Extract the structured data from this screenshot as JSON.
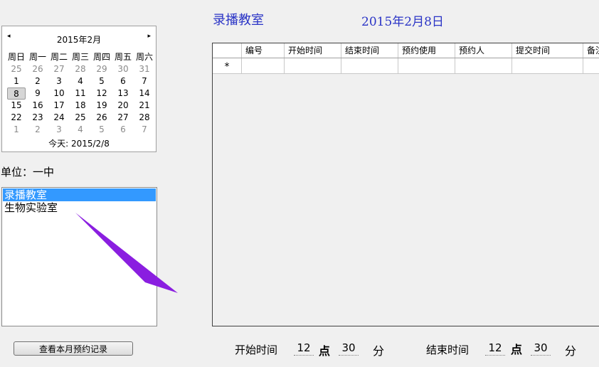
{
  "header": {
    "room_title": "录播教室",
    "date_title": "2015年2月8日"
  },
  "calendar": {
    "month_label": "2015年2月",
    "prev_glyph": "◂",
    "next_glyph": "▸",
    "weekdays": [
      "周日",
      "周一",
      "周二",
      "周三",
      "周四",
      "周五",
      "周六"
    ],
    "rows": [
      [
        "25",
        "26",
        "27",
        "28",
        "29",
        "30",
        "31"
      ],
      [
        "1",
        "2",
        "3",
        "4",
        "5",
        "6",
        "7"
      ],
      [
        "8",
        "9",
        "10",
        "11",
        "12",
        "13",
        "14"
      ],
      [
        "15",
        "16",
        "17",
        "18",
        "19",
        "20",
        "21"
      ],
      [
        "22",
        "23",
        "24",
        "25",
        "26",
        "27",
        "28"
      ],
      [
        "1",
        "2",
        "3",
        "4",
        "5",
        "6",
        "7"
      ]
    ],
    "today_label": "今天: 2015/2/8"
  },
  "unit": {
    "label": "单位：一中"
  },
  "rooms": {
    "items": [
      "录播教室",
      "生物实验室"
    ],
    "selected_index": 0
  },
  "grid": {
    "columns": [
      "编号",
      "开始时间",
      "结束时间",
      "预约使用",
      "预约人",
      "提交时间",
      "备注"
    ],
    "new_row_marker": "*"
  },
  "controls": {
    "view_month_button": "查看本月预约记录",
    "start_label": "开始时间",
    "start_hour": "12",
    "start_minute": "30",
    "end_label": "结束时间",
    "end_hour": "12",
    "end_minute": "30",
    "hour_unit": "点",
    "minute_unit": "分"
  },
  "annotation": {
    "arrow_color": "#8a1ee0"
  }
}
